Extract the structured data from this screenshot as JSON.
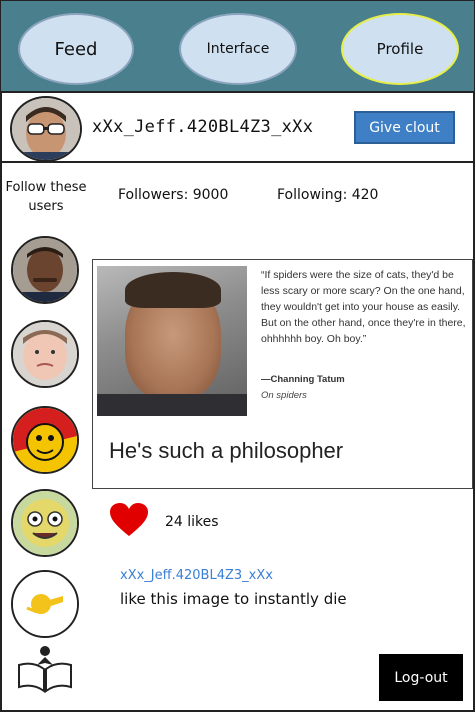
{
  "nav": {
    "feed": "Feed",
    "interface": "Interface",
    "profile": "Profile"
  },
  "profile": {
    "username": "xXx_Jeff.420BL4Z3_xXx",
    "give_clout_label": "Give clout"
  },
  "stats": {
    "follow_these_users": "Follow these users",
    "followers": "Followers: 9000",
    "following": "Following: 420"
  },
  "post": {
    "quote": "“If spiders were the size of cats, they'd be less scary or more scary? On the one hand, they wouldn't get into your house as easily. But on the other hand, once they're in there, ohhhhhh boy. Oh boy.”",
    "quote_author": "—Channing Tatum",
    "quote_source": "On spiders",
    "caption": "He's such a philosopher",
    "likes": "24 likes"
  },
  "comment": {
    "username": "xXx_Jeff.420BL4Z3_xXx",
    "text": "like this image to instantly die"
  },
  "footer": {
    "logout_label": "Log-out"
  },
  "colors": {
    "header_bg": "#4a7f8e",
    "nav_pill": "#cfe0f0",
    "active_outline": "#e6ef4a",
    "clout_button": "#3f7fc5",
    "heart": "#e00000",
    "link": "#3a7fd6"
  }
}
